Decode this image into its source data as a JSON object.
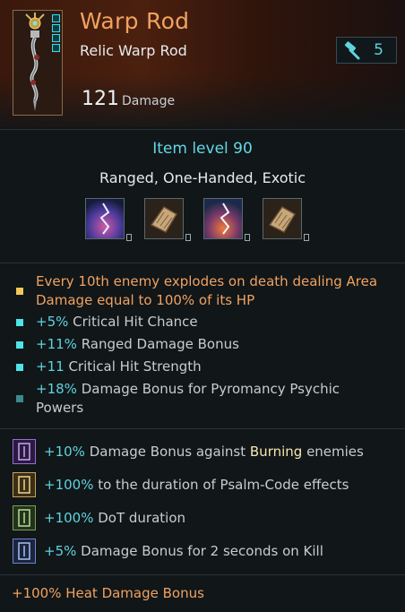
{
  "item": {
    "name": "Warp Rod",
    "subtitle": "Relic Warp Rod",
    "power": "5",
    "damage_value": "121",
    "damage_label": "Damage",
    "item_level": "Item level 90",
    "tags": "Ranged, One-Handed, Exotic"
  },
  "colors": {
    "title": "#f0a261",
    "accent_cyan": "#5fd3df",
    "legendary_orange": "#f0a261",
    "burning_yellow": "#f7e7b1"
  },
  "mod_slots": [
    {
      "icon": "purple-warp-lightning-icon"
    },
    {
      "icon": "brown-scroll-relic-icon"
    },
    {
      "icon": "orange-warp-lightning-icon"
    },
    {
      "icon": "brown-scroll-relic-icon"
    }
  ],
  "stats": [
    {
      "text": "Every 10th enemy explodes on death dealing Area Damage equal to 100% of its HP",
      "bullet": "gold"
    },
    {
      "value": "+5%",
      "text": "Critical Hit Chance",
      "bullet": "cyan"
    },
    {
      "value": "+11%",
      "text": "Ranged Damage Bonus",
      "bullet": "cyan"
    },
    {
      "value": "+11",
      "text": "Critical Hit Strength",
      "bullet": "cyan"
    },
    {
      "value": "+18%",
      "text": "Damage Bonus for Pyromancy Psychic Powers",
      "bullet": "teal-dim"
    }
  ],
  "augments": [
    {
      "value": "+10%",
      "pre": "Damage Bonus against ",
      "keyword": "Burning",
      "post": " enemies",
      "icon": "purple-rune-icon"
    },
    {
      "value": "+100%",
      "text": "to the duration of Psalm-Code effects",
      "icon": "gold-rune-icon"
    },
    {
      "value": "+100%",
      "text": "DoT duration",
      "icon": "green-rune-icon"
    },
    {
      "value": "+5%",
      "text": "Damage Bonus for 2 seconds on Kill",
      "icon": "blue-rune-icon"
    }
  ],
  "footer": "+100% Heat Damage Bonus"
}
